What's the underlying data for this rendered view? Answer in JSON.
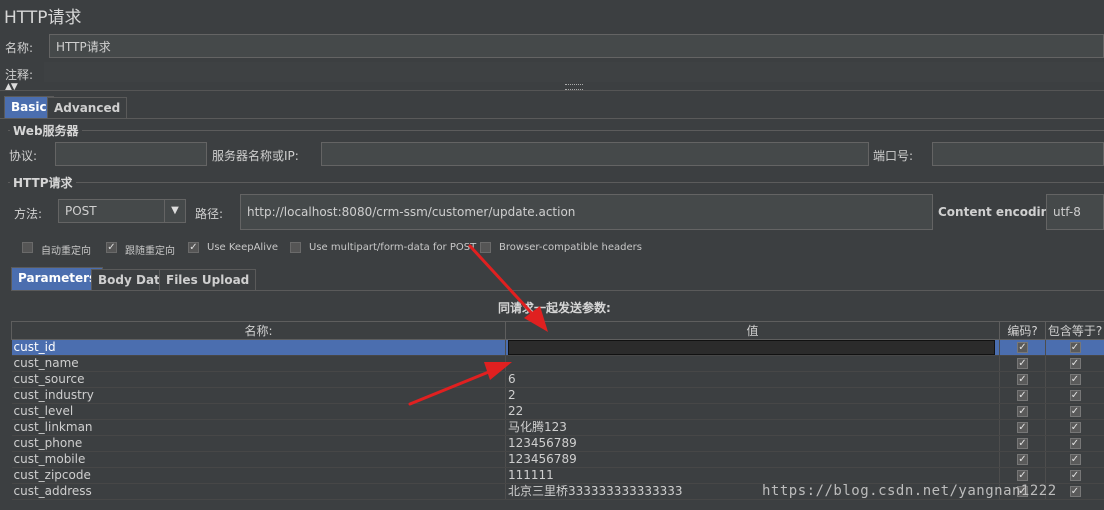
{
  "panel": {
    "title": "HTTP请求"
  },
  "name_row": {
    "label": "名称:",
    "value": "HTTP请求"
  },
  "comment_row": {
    "label": "注释:",
    "value": ""
  },
  "main_tabs": [
    {
      "label": "Basic",
      "active": true
    },
    {
      "label": "Advanced",
      "active": false
    }
  ],
  "web_server": {
    "title": "Web服务器",
    "protocol_label": "协议:",
    "protocol_value": "",
    "server_label": "服务器名称或IP:",
    "server_value": "",
    "port_label": "端口号:",
    "port_value": ""
  },
  "http_request": {
    "title": "HTTP请求",
    "method_label": "方法:",
    "method_value": "POST",
    "path_label": "路径:",
    "path_value": "http://localhost:8080/crm-ssm/customer/update.action",
    "encoding_label": "Content encoding:",
    "encoding_value": "utf-8"
  },
  "options": [
    {
      "label": "自动重定向",
      "checked": false
    },
    {
      "label": "跟随重定向",
      "checked": true
    },
    {
      "label": "Use KeepAlive",
      "checked": true
    },
    {
      "label": "Use multipart/form-data for POST",
      "checked": false
    },
    {
      "label": "Browser-compatible headers",
      "checked": false
    }
  ],
  "param_tabs": [
    {
      "label": "Parameters",
      "active": true
    },
    {
      "label": "Body Data",
      "active": false
    },
    {
      "label": "Files Upload",
      "active": false
    }
  ],
  "params": {
    "caption": "同请求一起发送参数:",
    "columns": [
      "名称:",
      "值",
      "编码?",
      "包含等于?"
    ],
    "rows": [
      {
        "name": "cust_id",
        "value": "",
        "encode": true,
        "include_equals": true,
        "selected": true
      },
      {
        "name": "cust_name",
        "value": "",
        "encode": true,
        "include_equals": true,
        "selected": false
      },
      {
        "name": "cust_source",
        "value": "6",
        "encode": true,
        "include_equals": true,
        "selected": false
      },
      {
        "name": "cust_industry",
        "value": "2",
        "encode": true,
        "include_equals": true,
        "selected": false
      },
      {
        "name": "cust_level",
        "value": "22",
        "encode": true,
        "include_equals": true,
        "selected": false
      },
      {
        "name": "cust_linkman",
        "value": "马化腾123",
        "encode": true,
        "include_equals": true,
        "selected": false
      },
      {
        "name": "cust_phone",
        "value": "123456789",
        "encode": true,
        "include_equals": true,
        "selected": false
      },
      {
        "name": "cust_mobile",
        "value": "123456789",
        "encode": true,
        "include_equals": true,
        "selected": false
      },
      {
        "name": "cust_zipcode",
        "value": "111111",
        "encode": true,
        "include_equals": true,
        "selected": false
      },
      {
        "name": "cust_address",
        "value": "北京三里桥333333333333333",
        "encode": true,
        "include_equals": true,
        "selected": false
      }
    ]
  },
  "watermark": "https://blog.csdn.net/yangnan1222",
  "colors": {
    "background": "#3c3f41",
    "selection": "#4b6eaf",
    "annotation_arrow": "#e02020"
  }
}
